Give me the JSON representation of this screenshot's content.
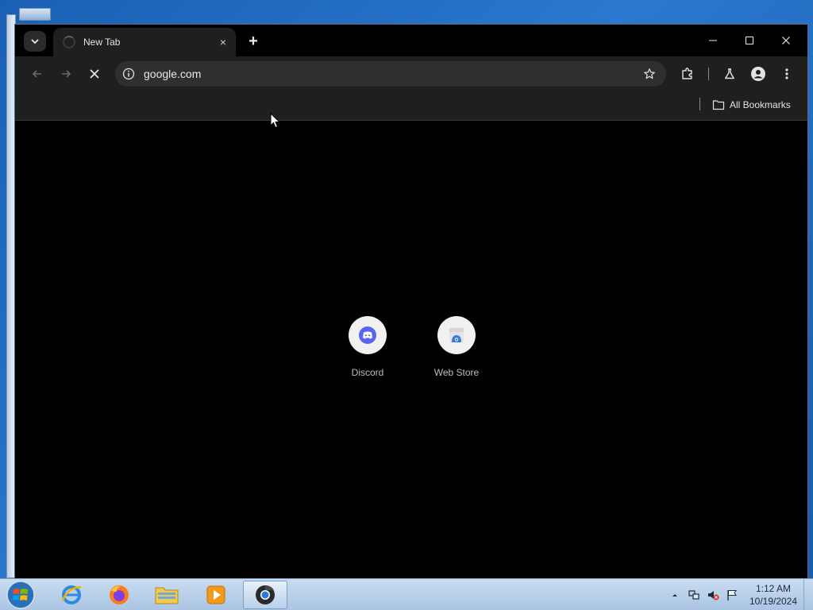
{
  "browser": {
    "tab": {
      "title": "New Tab",
      "close_glyph": "×"
    },
    "new_tab_glyph": "+",
    "omnibox": {
      "url": "google.com"
    },
    "bookmarks_bar": {
      "all_bookmarks": "All Bookmarks"
    },
    "shortcuts": [
      {
        "label": "Discord",
        "icon": "discord-icon"
      },
      {
        "label": "Web Store",
        "icon": "web-store-icon"
      }
    ],
    "colors": {
      "frame": "#000000",
      "toolbar": "#1f1f1f",
      "omnibox": "#2f2f2f",
      "discord": "#5865f2"
    }
  },
  "taskbar": {
    "items": [
      "start-orb",
      "internet-explorer",
      "firefox",
      "file-explorer",
      "media-player",
      "chrome"
    ],
    "clock": {
      "time": "1:12 AM",
      "date": "10/19/2024"
    }
  }
}
